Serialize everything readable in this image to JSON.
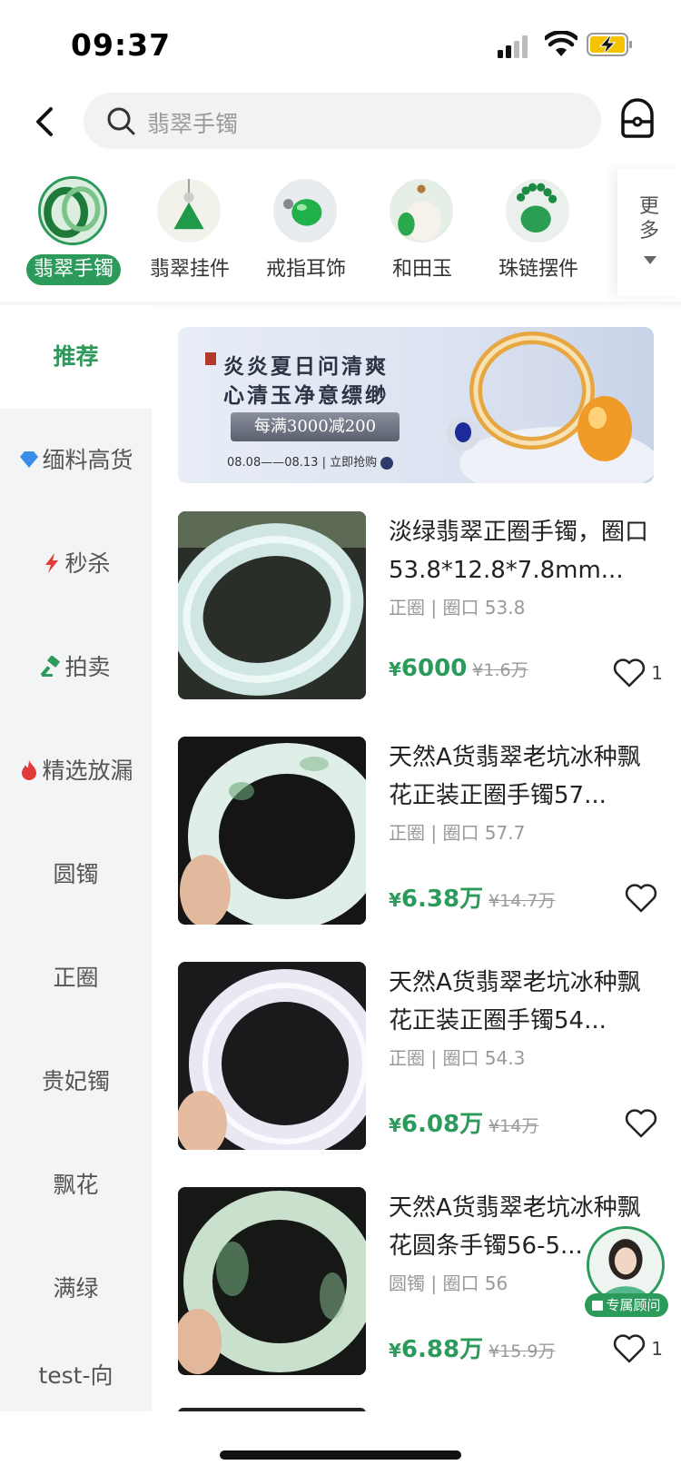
{
  "status": {
    "time": "09:37"
  },
  "search": {
    "placeholder": "翡翠手镯"
  },
  "categories": [
    {
      "label": "翡翠手镯",
      "active": true
    },
    {
      "label": "翡翠挂件",
      "active": false
    },
    {
      "label": "戒指耳饰",
      "active": false
    },
    {
      "label": "和田玉",
      "active": false
    },
    {
      "label": "珠链摆件",
      "active": false
    }
  ],
  "more_label": "更多",
  "sidebar": [
    {
      "label": "推荐",
      "icon": ""
    },
    {
      "label": "缅料高货",
      "icon": "diamond-icon"
    },
    {
      "label": "秒杀",
      "icon": "lightning-icon"
    },
    {
      "label": "拍卖",
      "icon": "gavel-icon"
    },
    {
      "label": "精选放漏",
      "icon": "flame-icon"
    },
    {
      "label": "圆镯",
      "icon": ""
    },
    {
      "label": "正圈",
      "icon": ""
    },
    {
      "label": "贵妃镯",
      "icon": ""
    },
    {
      "label": "飘花",
      "icon": ""
    },
    {
      "label": "满绿",
      "icon": ""
    },
    {
      "label": "test-向",
      "icon": ""
    }
  ],
  "banner": {
    "line1": "炎炎夏日问清爽",
    "line2": "心清玉净意缥缈",
    "promo": "每满3000减200",
    "date": "08.08——08.13 | 立即抢购"
  },
  "products": [
    {
      "title": "淡绿翡翠正圈手镯，圈口53.8*12.8*7.8mm...",
      "spec": "正圈 | 圈口 53.8",
      "price": "6000",
      "orig": "¥1.6万",
      "likes": "1"
    },
    {
      "title": "天然A货翡翠老坑冰种飘花正装正圈手镯57...",
      "spec": "正圈 | 圈口 57.7",
      "price": "6.38万",
      "orig": "¥14.7万",
      "likes": ""
    },
    {
      "title": "天然A货翡翠老坑冰种飘花正装正圈手镯54...",
      "spec": "正圈 | 圈口 54.3",
      "price": "6.08万",
      "orig": "¥14万",
      "likes": ""
    },
    {
      "title": "天然A货翡翠老坑冰种飘花圆条手镯56-5...",
      "spec": "圆镯 | 圈口 56",
      "price": "6.88万",
      "orig": "¥15.9万",
      "likes": "1"
    }
  ],
  "currency": "¥",
  "advisor": {
    "label": "专属顾问"
  },
  "colors": {
    "accent": "#2c9a5a",
    "sidebar_bg": "#f3f4f6"
  }
}
